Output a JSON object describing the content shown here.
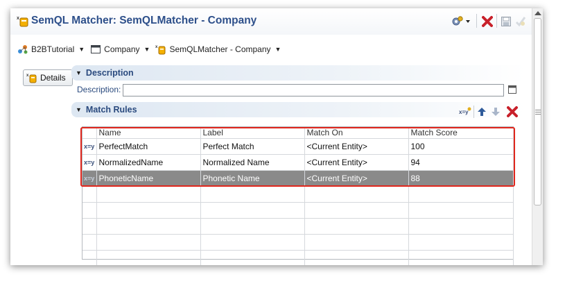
{
  "titlebar": {
    "title": "SemQL Matcher: SemQLMatcher - Company"
  },
  "breadcrumb": {
    "items": [
      {
        "label": "B2BTutorial",
        "icon": "model-icon"
      },
      {
        "label": "Company",
        "icon": "entity-icon"
      },
      {
        "label": "SemQLMatcher - Company",
        "icon": "matcher-icon"
      }
    ]
  },
  "sidebar": {
    "details_label": "Details"
  },
  "description_section": {
    "header": "Description",
    "field_label": "Description:",
    "field_value": ""
  },
  "match_rules_section": {
    "header": "Match Rules",
    "columns": [
      "Name",
      "Label",
      "Match On",
      "Match Score"
    ],
    "rows": [
      {
        "icon": "x=y",
        "name": "PerfectMatch",
        "label": "Perfect Match",
        "match_on": "<Current Entity>",
        "score": "100"
      },
      {
        "icon": "x=y",
        "name": "NormalizedName",
        "label": "Normalized Name",
        "match_on": "<Current Entity>",
        "score": "94"
      },
      {
        "icon": "x=y",
        "name": "PhoneticName",
        "label": "Phonetic Name",
        "match_on": "<Current Entity>",
        "score": "88"
      }
    ],
    "selected_row": 2
  },
  "colors": {
    "title": "#2d4f8a",
    "section_header": "#2a4a7e",
    "highlight": "#e0261c",
    "selected_row": "#8a8a8a",
    "delete_red": "#c8202a"
  }
}
